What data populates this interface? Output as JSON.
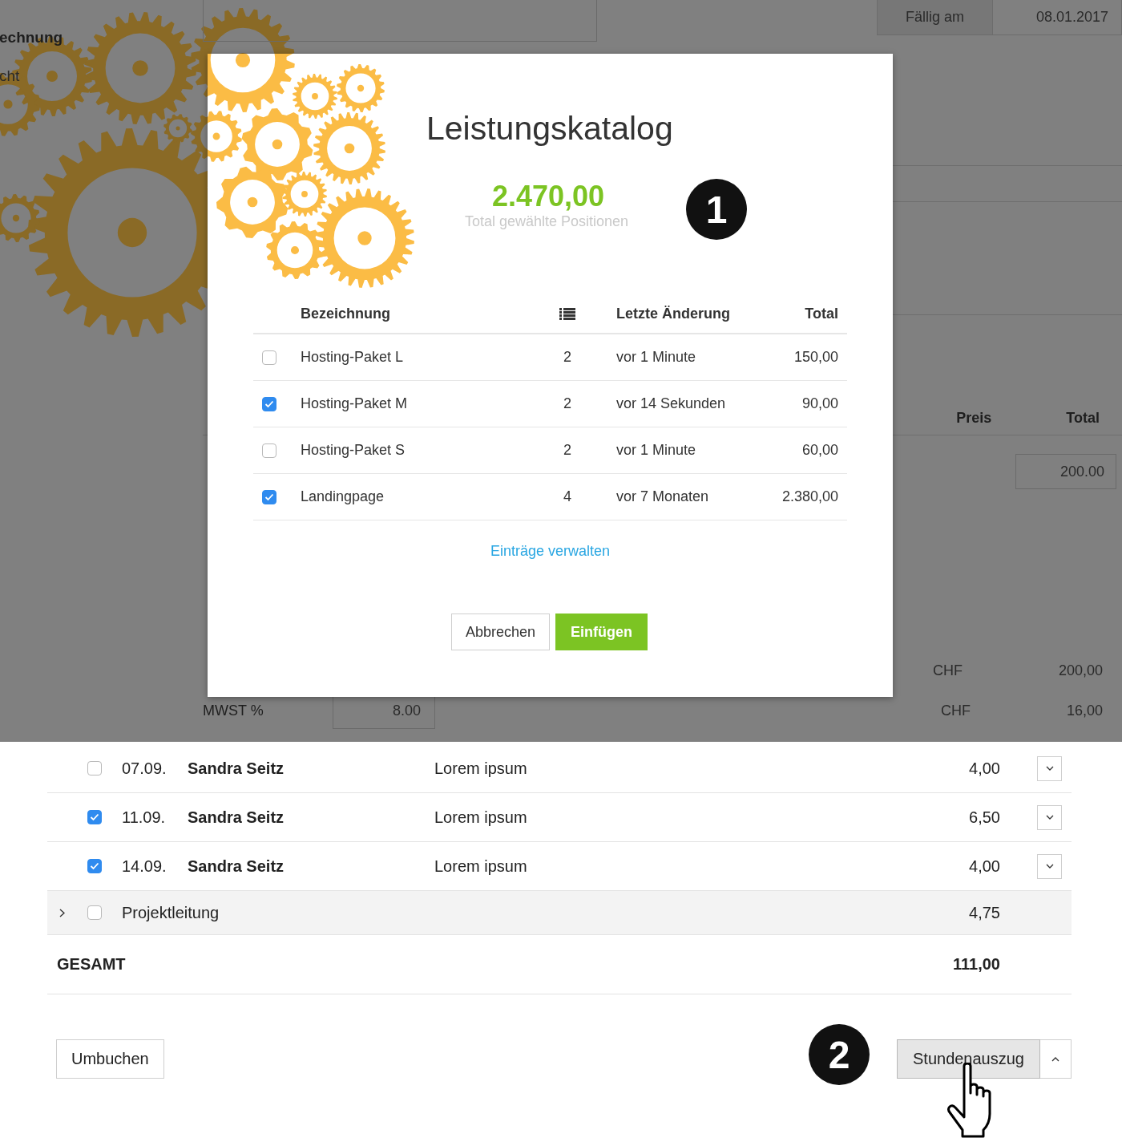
{
  "background_page": {
    "sidebar_items": [
      {
        "label": "echnung",
        "bold": true
      },
      {
        "label": "cht",
        "bold": false
      }
    ],
    "due_date": {
      "label": "Fällig am",
      "value": "08.01.2017"
    },
    "columns": [
      "Preis",
      "Total"
    ],
    "price_field": {
      "value": "200.00"
    },
    "totals": [
      {
        "currency": "CHF",
        "amount": "200,00"
      },
      {
        "label": "MWST %",
        "rate": "8.00",
        "currency": "CHF",
        "amount": "16,00"
      }
    ]
  },
  "modal": {
    "title": "Leistungskatalog",
    "total": "2.470,00",
    "total_label": "Total gewählte Positionen",
    "columns": {
      "name": "Bezeichnung",
      "changed": "Letzte Änderung",
      "total": "Total"
    },
    "rows": [
      {
        "name": "Hosting-Paket L",
        "count": "2",
        "changed": "vor 1 Minute",
        "total": "150,00",
        "checked": false
      },
      {
        "name": "Hosting-Paket M",
        "count": "2",
        "changed": "vor 14 Sekunden",
        "total": "90,00",
        "checked": true
      },
      {
        "name": "Hosting-Paket S",
        "count": "2",
        "changed": "vor 1 Minute",
        "total": "60,00",
        "checked": false
      },
      {
        "name": "Landingpage",
        "count": "4",
        "changed": "vor 7 Monaten",
        "total": "2.380,00",
        "checked": true
      }
    ],
    "link": "Einträge verwalten",
    "buttons": [
      {
        "label": "Abbrechen",
        "kind": "secondary"
      },
      {
        "label": "Einfügen",
        "kind": "primary"
      }
    ]
  },
  "hours": {
    "rows": [
      {
        "date": "07.09.",
        "name": "Sandra Seitz",
        "text": "Lorem ipsum",
        "hours": "4,00",
        "checked": false
      },
      {
        "date": "11.09.",
        "name": "Sandra Seitz",
        "text": "Lorem ipsum",
        "hours": "6,50",
        "checked": true
      },
      {
        "date": "14.09.",
        "name": "Sandra Seitz",
        "text": "Lorem ipsum",
        "hours": "4,00",
        "checked": true
      }
    ],
    "group": {
      "label": "Projektleitung",
      "hours": "4,75",
      "checked": false,
      "expanded": false
    },
    "total": {
      "label": "GESAMT",
      "value": "111,00"
    },
    "buttons": {
      "left": "Umbuchen",
      "right": "Stundenauszug"
    }
  },
  "badges": [
    "1",
    "2"
  ]
}
